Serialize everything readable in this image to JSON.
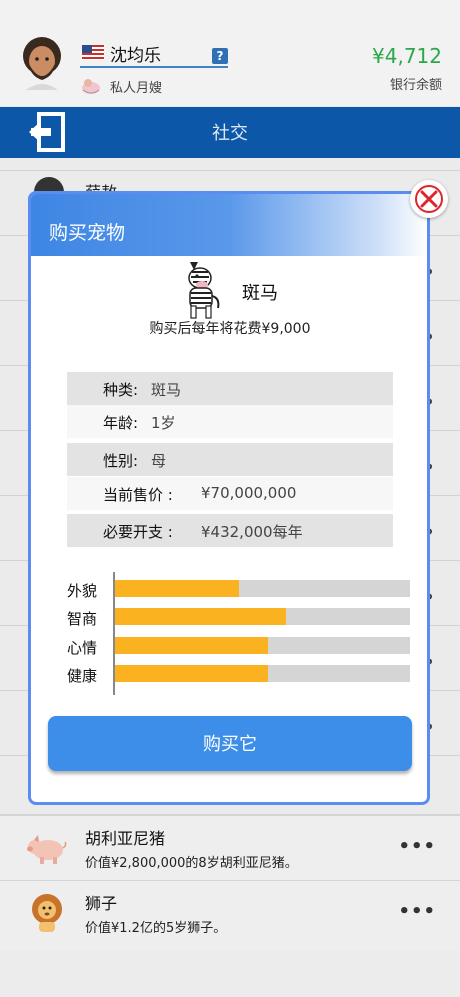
{
  "player": {
    "name": "沈均乐",
    "help": "?",
    "status": "私人月嫂",
    "balance": "¥4,712",
    "balance_label": "银行余额"
  },
  "titlebar": {
    "title": "社交"
  },
  "background_list": {
    "partial_name": "薛敖",
    "items": [
      {
        "name": "胡利亚尼猪",
        "desc": "价值¥2,800,000的8岁胡利亚尼猪。",
        "more": "•••",
        "icon": "pig-icon"
      },
      {
        "name": "狮子",
        "desc": "价值¥1.2亿的5岁狮子。",
        "more": "•••",
        "icon": "lion-icon"
      }
    ]
  },
  "modal": {
    "title": "购买宠物",
    "pet_name": "斑马",
    "pet_icon": "zebra-icon",
    "yearly_cost": "购买后每年将花费¥9,000",
    "details": [
      {
        "label": "种类:",
        "value": "斑马"
      },
      {
        "label": "年龄:",
        "value": "1岁"
      },
      {
        "label": "性别:",
        "value": "母"
      },
      {
        "label": "当前售价 :",
        "value": "¥70,000,000"
      },
      {
        "label": "必要开支 :",
        "value": "¥432,000每年"
      }
    ],
    "stats": [
      {
        "label": "外貌",
        "value": 0.42
      },
      {
        "label": "智商",
        "value": 0.58
      },
      {
        "label": "心情",
        "value": 0.52
      },
      {
        "label": "健康",
        "value": 0.52
      }
    ],
    "buy_label": "购买它"
  },
  "colors": {
    "titlebar": "#0d57a8",
    "balance": "#2ba84a",
    "modal_border": "#5b8cf2",
    "stat_fill": "#fbb220",
    "buy_button": "#3d8ee8",
    "close": "#e0242b"
  }
}
